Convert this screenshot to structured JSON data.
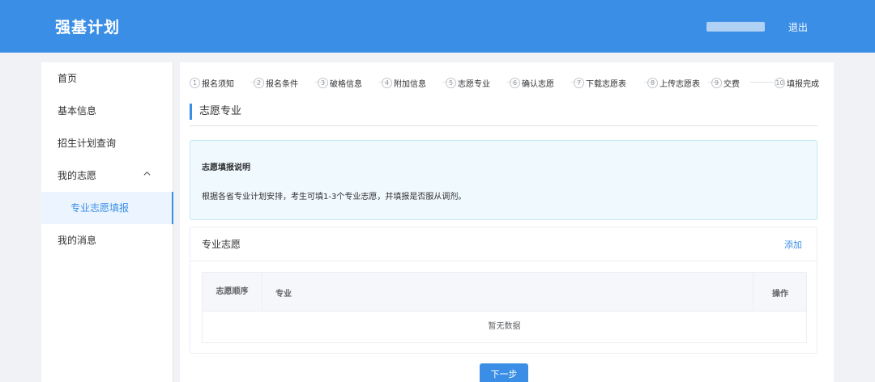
{
  "header": {
    "brand": "强基计划",
    "logout": "退出"
  },
  "sidebar": {
    "items": [
      {
        "label": "首页"
      },
      {
        "label": "基本信息"
      },
      {
        "label": "招生计划查询"
      },
      {
        "label": "我的志愿"
      },
      {
        "label": "专业志愿填报"
      },
      {
        "label": "我的消息"
      }
    ],
    "expand_icon": "chevron-up-icon"
  },
  "steps": [
    {
      "num": "1",
      "label": "报名须知"
    },
    {
      "num": "2",
      "label": "报名条件"
    },
    {
      "num": "3",
      "label": "破格信息"
    },
    {
      "num": "4",
      "label": "附加信息"
    },
    {
      "num": "5",
      "label": "志愿专业"
    },
    {
      "num": "6",
      "label": "确认志愿"
    },
    {
      "num": "7",
      "label": "下载志愿表"
    },
    {
      "num": "8",
      "label": "上传志愿表"
    },
    {
      "num": "9",
      "label": "交费"
    },
    {
      "num": "10",
      "label": "填报完成"
    }
  ],
  "section": {
    "title": "志愿专业"
  },
  "notice": {
    "title": "志愿填报说明",
    "text": "根据各省专业计划安排，考生可填1-3个专业志愿，并填报是否服从调剂。"
  },
  "card": {
    "title": "专业志愿",
    "add_label": "添加",
    "table": {
      "columns": [
        "志愿顺序",
        "专业",
        "操作"
      ],
      "empty_text": "暂无数据"
    }
  },
  "footer": {
    "next_label": "下一步"
  },
  "colors": {
    "primary": "#3a8ee6",
    "notice_bg": "#f0f9fd"
  }
}
